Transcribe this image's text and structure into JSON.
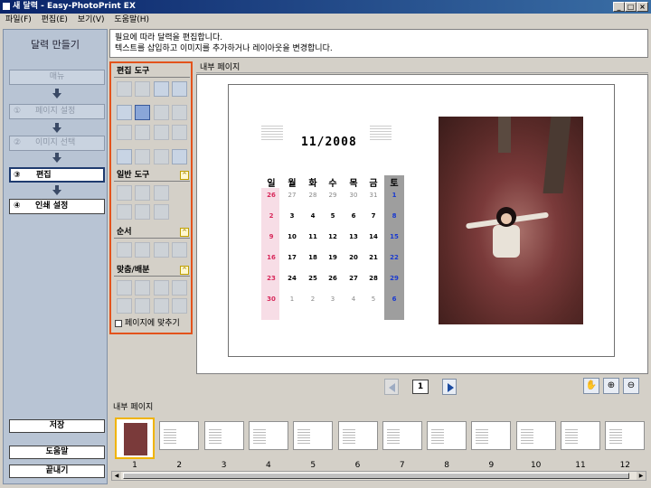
{
  "window": {
    "title": "새 달력 - Easy-PhotoPrint EX"
  },
  "menu": [
    "파일(F)",
    "편집(E)",
    "보기(V)",
    "도움말(H)"
  ],
  "sidebar": {
    "title": "달력 만들기",
    "steps": [
      {
        "num": "",
        "label": "매뉴",
        "state": "dim"
      },
      {
        "num": "①",
        "label": "페이지 설정",
        "state": "dim"
      },
      {
        "num": "②",
        "label": "이미지 선택",
        "state": "dim"
      },
      {
        "num": "③",
        "label": "편집",
        "state": "active"
      },
      {
        "num": "④",
        "label": "인쇄 설정",
        "state": "bold"
      }
    ],
    "save": "저장",
    "help": "도움말",
    "exit": "끝내기"
  },
  "instructions": {
    "line1": "필요에 따라 달력을 편집합니다.",
    "line2": "텍스트를 삽입하고 이미지를 추가하거나 레이아웃을 변경합니다."
  },
  "tools": {
    "edit_title": "편집 도구",
    "general_title": "일반 도구",
    "order_title": "순서",
    "align_title": "맞춤/배분",
    "fit_label": "페이지에 맞추기"
  },
  "preview": {
    "header": "내부 페이지"
  },
  "calendar": {
    "title": "11/2008",
    "day_names": [
      "일",
      "월",
      "화",
      "수",
      "목",
      "금",
      "토"
    ],
    "weeks": [
      [
        "26",
        "27",
        "28",
        "29",
        "30",
        "31",
        "1"
      ],
      [
        "2",
        "3",
        "4",
        "5",
        "6",
        "7",
        "8"
      ],
      [
        "9",
        "10",
        "11",
        "12",
        "13",
        "14",
        "15"
      ],
      [
        "16",
        "17",
        "18",
        "19",
        "20",
        "21",
        "22"
      ],
      [
        "23",
        "24",
        "25",
        "26",
        "27",
        "28",
        "29"
      ],
      [
        "30",
        "1",
        "2",
        "3",
        "4",
        "5",
        "6"
      ]
    ],
    "colors": {
      "sunday": "#d8285a",
      "saturday": "#1a3ad0",
      "other_month": "#888888"
    }
  },
  "navigation": {
    "page": "1"
  },
  "thumbnails": {
    "header": "내부 페이지",
    "pages": [
      "1",
      "2",
      "3",
      "4",
      "5",
      "6",
      "7",
      "8",
      "9",
      "10",
      "11",
      "12"
    ],
    "selected": "1"
  },
  "accent": "#e3531c"
}
